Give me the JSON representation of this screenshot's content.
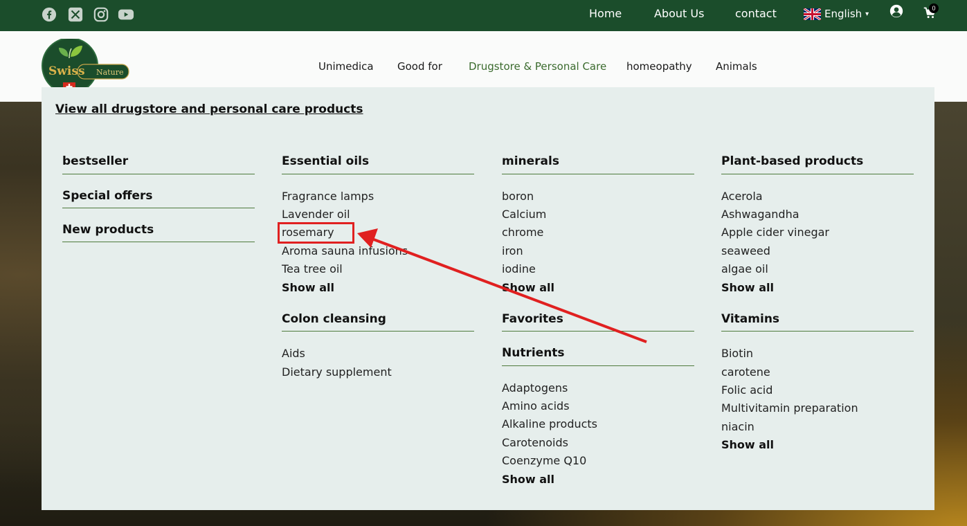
{
  "colors": {
    "topbar": "#1b4d2b",
    "accent": "#3b6b2e",
    "menu_bg": "#e6eeec",
    "highlight": "#e02020"
  },
  "social": [
    {
      "icon": "facebook-icon"
    },
    {
      "icon": "x-twitter-icon"
    },
    {
      "icon": "instagram-icon"
    },
    {
      "icon": "youtube-icon"
    }
  ],
  "topnav": {
    "home": "Home",
    "about": "About Us",
    "contact": "contact"
  },
  "language": {
    "icon": "uk-flag-icon",
    "label": "English",
    "caret": "▾"
  },
  "cart": {
    "count": "0"
  },
  "logo": {
    "brand": "Swiss",
    "sub": "Nature"
  },
  "mainnav": [
    "Unimedica",
    "Good for",
    "Drugstore & Personal Care",
    "homeopathy",
    "Animals"
  ],
  "mega": {
    "view_all": "View all drugstore and personal care products",
    "col1": [
      "bestseller",
      "Special offers",
      "New products"
    ],
    "essential_oils": {
      "title": "Essential oils",
      "items": [
        "Fragrance lamps",
        "Lavender oil",
        "rosemary",
        "Aroma sauna infusions",
        "Tea tree oil"
      ],
      "show_all": "Show all"
    },
    "colon": {
      "title": "Colon cleansing",
      "items": [
        "Aids",
        "Dietary supplement"
      ]
    },
    "minerals": {
      "title": "minerals",
      "items": [
        "boron",
        "Calcium",
        "chrome",
        "iron",
        "iodine"
      ],
      "show_all": "Show all"
    },
    "favorites": {
      "title": "Favorites"
    },
    "nutrients": {
      "title": "Nutrients",
      "items": [
        "Adaptogens",
        "Amino acids",
        "Alkaline products",
        "Carotenoids",
        "Coenzyme Q10"
      ],
      "show_all": "Show all"
    },
    "plant": {
      "title": "Plant-based products",
      "items": [
        "Acerola",
        "Ashwagandha",
        "Apple cider vinegar",
        "seaweed",
        "algae oil"
      ],
      "show_all": "Show all"
    },
    "vitamins": {
      "title": "Vitamins",
      "items": [
        "Biotin",
        "carotene",
        "Folic acid",
        "Multivitamin preparation",
        "niacin"
      ],
      "show_all": "Show all"
    }
  }
}
